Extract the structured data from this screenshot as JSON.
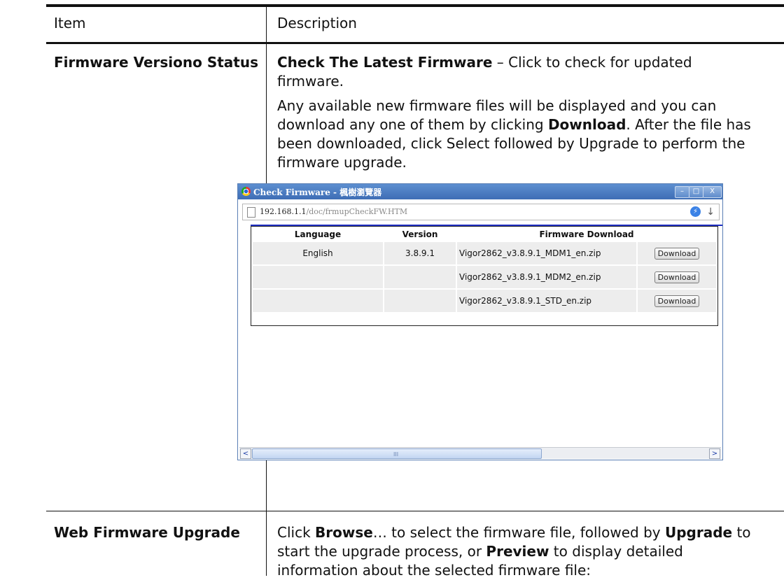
{
  "table": {
    "headers": {
      "item": "Item",
      "description": "Description"
    },
    "row1": {
      "item": "Firmware Versiono Status",
      "p1_bold": "Check The Latest Firmware",
      "p1_rest": " – Click to check for updated firmware.",
      "p2_a": "Any available new firmware files will be displayed and you can download any one of them by clicking ",
      "p2_bold": "Download",
      "p2_b": ". After the file has been downloaded, click Select followed by Upgrade to perform the firmware upgrade."
    },
    "row2": {
      "item": "Web Firmware Upgrade",
      "a": "Click ",
      "b_bold": "Browse",
      "c": "… to select the firmware file, followed by ",
      "d_bold": "Upgrade",
      "e": " to start the upgrade process, or ",
      "f_bold": "Preview",
      "g": " to display detailed information about the selected firmware file:"
    }
  },
  "browser": {
    "title": "Check Firmware - 楓樹瀏覽器",
    "url_host": "192.168.1.1",
    "url_path": "/doc/frmupCheckFW.HTM",
    "window_buttons": [
      "–",
      "□",
      "X"
    ],
    "columns": [
      "Language",
      "Version",
      "Firmware Download"
    ],
    "rows": [
      {
        "language": "English",
        "version": "3.8.9.1",
        "file": "Vigor2862_v3.8.9.1_MDM1_en.zip",
        "button": "Download"
      },
      {
        "language": "",
        "version": "",
        "file": "Vigor2862_v3.8.9.1_MDM2_en.zip",
        "button": "Download"
      },
      {
        "language": "",
        "version": "",
        "file": "Vigor2862_v3.8.9.1_STD_en.zip",
        "button": "Download"
      }
    ],
    "scroll": {
      "left_arrow": "<",
      "right_arrow": ">",
      "grip": "III"
    }
  }
}
